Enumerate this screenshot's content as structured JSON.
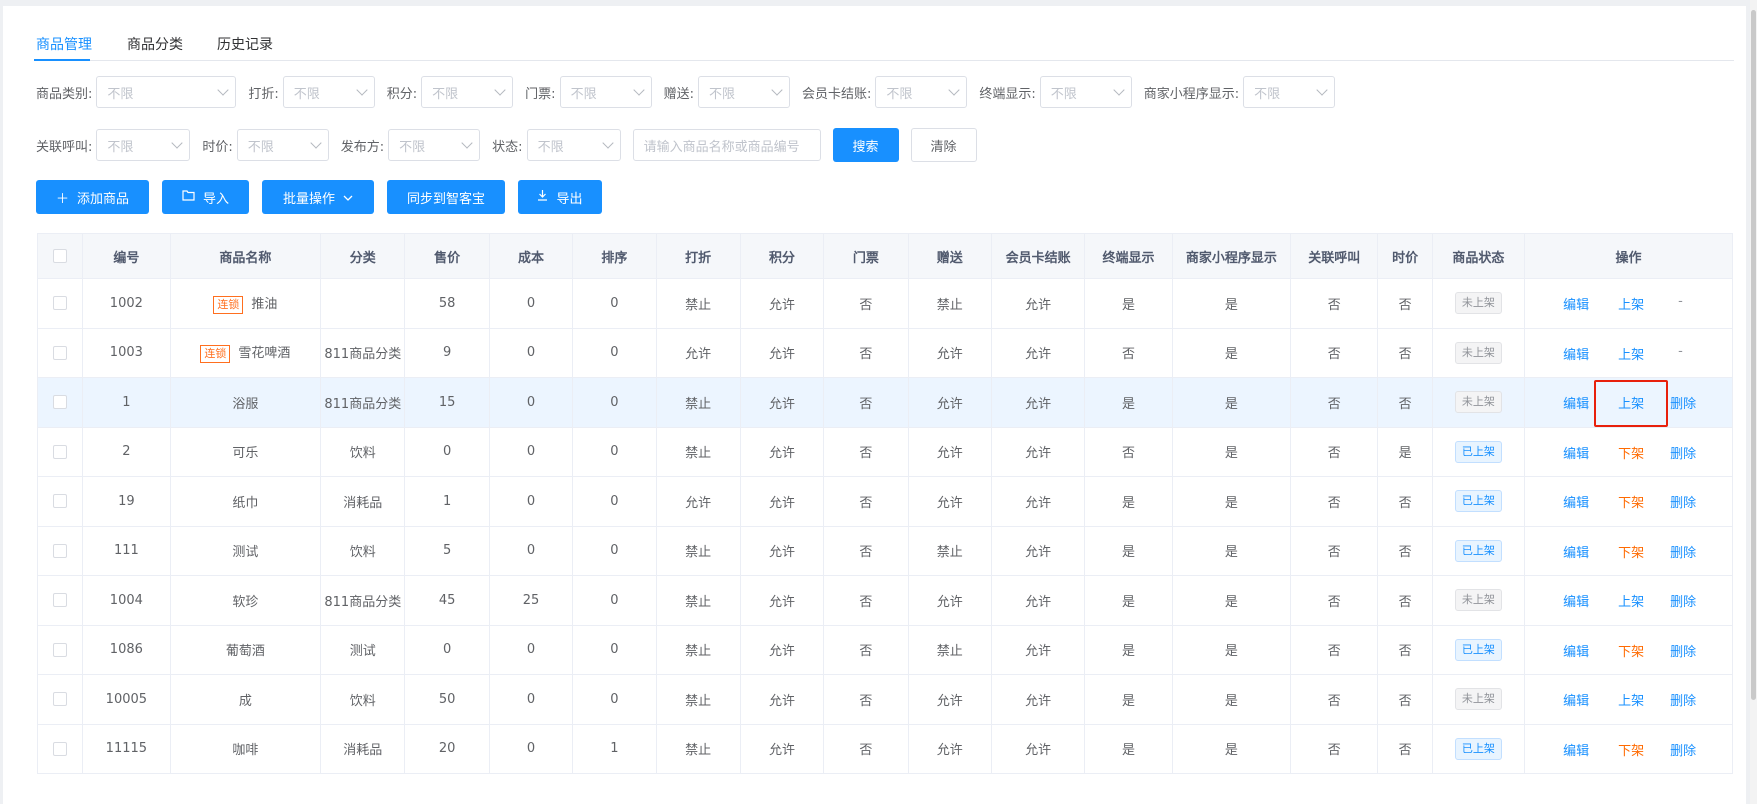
{
  "tabs": [
    {
      "label": "商品管理"
    },
    {
      "label": "商品分类"
    },
    {
      "label": "历史记录"
    }
  ],
  "filters": {
    "row1": [
      {
        "label": "商品类别:",
        "value": "不限"
      },
      {
        "label": "打折:",
        "value": "不限"
      },
      {
        "label": "积分:",
        "value": "不限"
      },
      {
        "label": "门票:",
        "value": "不限"
      },
      {
        "label": "赠送:",
        "value": "不限"
      },
      {
        "label": "会员卡结账:",
        "value": "不限"
      },
      {
        "label": "终端显示:",
        "value": "不限"
      },
      {
        "label": "商家小程序显示:",
        "value": "不限"
      }
    ],
    "row2": [
      {
        "label": "关联呼叫:",
        "value": "不限"
      },
      {
        "label": "时价:",
        "value": "不限"
      },
      {
        "label": "发布方:",
        "value": "不限"
      },
      {
        "label": "状态:",
        "value": "不限"
      }
    ],
    "search_placeholder": "请输入商品名称或商品编号",
    "search_button": "搜索",
    "clear_button": "清除"
  },
  "actions": {
    "add": "添加商品",
    "import": "导入",
    "batch": "批量操作",
    "sync": "同步到智客宝",
    "export": "导出"
  },
  "table": {
    "headers": [
      "编号",
      "商品名称",
      "分类",
      "售价",
      "成本",
      "排序",
      "打折",
      "积分",
      "门票",
      "赠送",
      "会员卡结账",
      "终端显示",
      "商家小程序显示",
      "关联呼叫",
      "时价",
      "商品状态",
      "操作"
    ],
    "chain_tag": "连锁",
    "rows": [
      {
        "id": "1002",
        "name": "推油",
        "chain": true,
        "category": "",
        "price": "58",
        "cost": "0",
        "sort": "0",
        "discount": "禁止",
        "points": "允许",
        "ticket": "否",
        "gift": "禁止",
        "card": "允许",
        "terminal": "是",
        "miniapp": "是",
        "call": "否",
        "timeprice": "否",
        "status": "未上架",
        "status_on": false,
        "op1": "编辑",
        "op2": "上架",
        "op3": "-"
      },
      {
        "id": "1003",
        "name": "雪花啤酒",
        "chain": true,
        "category": "811商品分类",
        "price": "9",
        "cost": "0",
        "sort": "0",
        "discount": "允许",
        "points": "允许",
        "ticket": "否",
        "gift": "允许",
        "card": "允许",
        "terminal": "否",
        "miniapp": "是",
        "call": "否",
        "timeprice": "否",
        "status": "未上架",
        "status_on": false,
        "op1": "编辑",
        "op2": "上架",
        "op3": "-"
      },
      {
        "id": "1",
        "name": "浴服",
        "chain": false,
        "category": "811商品分类",
        "price": "15",
        "cost": "0",
        "sort": "0",
        "discount": "禁止",
        "points": "允许",
        "ticket": "否",
        "gift": "允许",
        "card": "允许",
        "terminal": "是",
        "miniapp": "是",
        "call": "否",
        "timeprice": "否",
        "status": "未上架",
        "status_on": false,
        "op1": "编辑",
        "op2": "上架",
        "op3": "删除"
      },
      {
        "id": "2",
        "name": "可乐",
        "chain": false,
        "category": "饮料",
        "price": "0",
        "cost": "0",
        "sort": "0",
        "discount": "禁止",
        "points": "允许",
        "ticket": "否",
        "gift": "允许",
        "card": "允许",
        "terminal": "否",
        "miniapp": "是",
        "call": "否",
        "timeprice": "是",
        "status": "已上架",
        "status_on": true,
        "op1": "编辑",
        "op2": "下架",
        "op3": "删除"
      },
      {
        "id": "19",
        "name": "纸巾",
        "chain": false,
        "category": "消耗品",
        "price": "1",
        "cost": "0",
        "sort": "0",
        "discount": "允许",
        "points": "允许",
        "ticket": "否",
        "gift": "允许",
        "card": "允许",
        "terminal": "是",
        "miniapp": "是",
        "call": "否",
        "timeprice": "否",
        "status": "已上架",
        "status_on": true,
        "op1": "编辑",
        "op2": "下架",
        "op3": "删除"
      },
      {
        "id": "111",
        "name": "测试",
        "chain": false,
        "category": "饮料",
        "price": "5",
        "cost": "0",
        "sort": "0",
        "discount": "禁止",
        "points": "允许",
        "ticket": "否",
        "gift": "禁止",
        "card": "允许",
        "terminal": "是",
        "miniapp": "是",
        "call": "否",
        "timeprice": "否",
        "status": "已上架",
        "status_on": true,
        "op1": "编辑",
        "op2": "下架",
        "op3": "删除"
      },
      {
        "id": "1004",
        "name": "软珍",
        "chain": false,
        "category": "811商品分类",
        "price": "45",
        "cost": "25",
        "sort": "0",
        "discount": "禁止",
        "points": "允许",
        "ticket": "否",
        "gift": "允许",
        "card": "允许",
        "terminal": "是",
        "miniapp": "是",
        "call": "否",
        "timeprice": "否",
        "status": "未上架",
        "status_on": false,
        "op1": "编辑",
        "op2": "上架",
        "op3": "删除"
      },
      {
        "id": "1086",
        "name": "葡萄酒",
        "chain": false,
        "category": "测试",
        "price": "0",
        "cost": "0",
        "sort": "0",
        "discount": "禁止",
        "points": "允许",
        "ticket": "否",
        "gift": "禁止",
        "card": "允许",
        "terminal": "是",
        "miniapp": "是",
        "call": "否",
        "timeprice": "否",
        "status": "已上架",
        "status_on": true,
        "op1": "编辑",
        "op2": "下架",
        "op3": "删除"
      },
      {
        "id": "10005",
        "name": "成",
        "chain": false,
        "category": "饮料",
        "price": "50",
        "cost": "0",
        "sort": "0",
        "discount": "禁止",
        "points": "允许",
        "ticket": "否",
        "gift": "允许",
        "card": "允许",
        "terminal": "是",
        "miniapp": "是",
        "call": "否",
        "timeprice": "否",
        "status": "未上架",
        "status_on": false,
        "op1": "编辑",
        "op2": "上架",
        "op3": "删除"
      },
      {
        "id": "11115",
        "name": "咖啡",
        "chain": false,
        "category": "消耗品",
        "price": "20",
        "cost": "0",
        "sort": "1",
        "discount": "禁止",
        "points": "允许",
        "ticket": "否",
        "gift": "允许",
        "card": "允许",
        "terminal": "是",
        "miniapp": "是",
        "call": "否",
        "timeprice": "否",
        "status": "已上架",
        "status_on": true,
        "op1": "编辑",
        "op2": "下架",
        "op3": "删除"
      }
    ]
  },
  "colors": {
    "primary": "#1890ff",
    "warning": "#ff6a00",
    "highlight_box": "#e8200c",
    "row_highlight": "#ecf5ff"
  },
  "highlight": {
    "row_index": 2,
    "target": "op2"
  }
}
